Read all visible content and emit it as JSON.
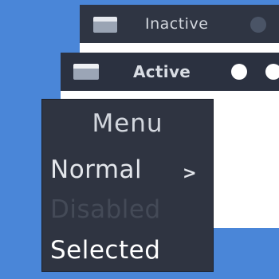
{
  "windows": {
    "inactive": {
      "title": "Inactive"
    },
    "active": {
      "title": "Active"
    }
  },
  "menu": {
    "title": "Menu",
    "items": [
      {
        "label": "Normal",
        "state": "normal",
        "has_submenu": true,
        "arrow": ">"
      },
      {
        "label": "Disabled",
        "state": "disabled",
        "has_submenu": false
      },
      {
        "label": "Selected",
        "state": "selected",
        "has_submenu": false
      }
    ]
  },
  "colors": {
    "desktop": "#4a86d8",
    "titlebar_active": "#2b3140",
    "titlebar_inactive": "#2f3543",
    "menu_bg": "#2f3441",
    "text_disabled": "#444a57"
  },
  "icons": {
    "window_app": "window-app-icon",
    "control_button": "circle-button-icon",
    "submenu": "chevron-right-icon"
  }
}
